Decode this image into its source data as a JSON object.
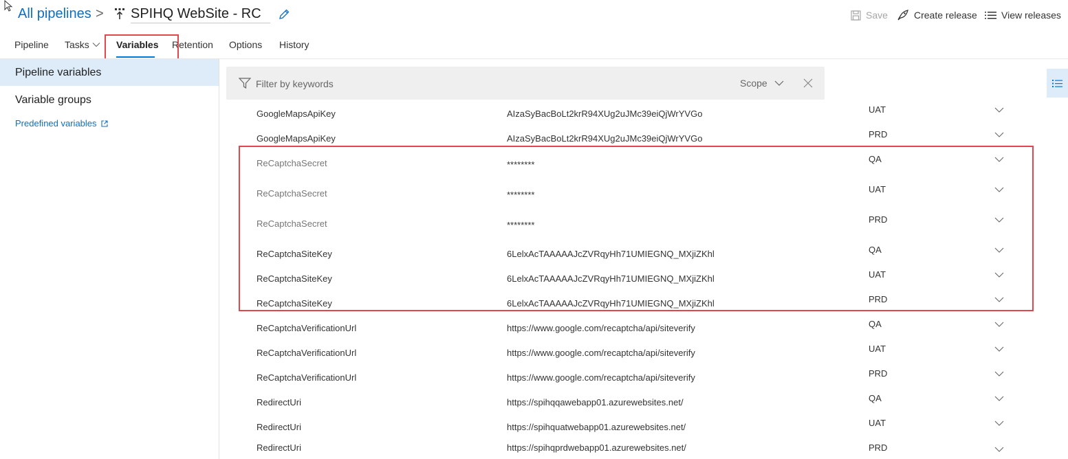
{
  "header": {
    "breadcrumb_root": "All pipelines",
    "breadcrumb_sep": ">",
    "pipeline_name": "SPIHQ WebSite - RC"
  },
  "commands": {
    "save": "Save",
    "create_release": "Create release",
    "view_releases": "View releases"
  },
  "tabs": [
    {
      "label": "Pipeline",
      "active": false
    },
    {
      "label": "Tasks",
      "active": false
    },
    {
      "label": "Variables",
      "active": true
    },
    {
      "label": "Retention",
      "active": false
    },
    {
      "label": "Options",
      "active": false
    },
    {
      "label": "History",
      "active": false
    }
  ],
  "nav": {
    "pipeline_variables": "Pipeline variables",
    "variable_groups": "Variable groups",
    "predefined_variables": "Predefined variables"
  },
  "filter": {
    "placeholder": "Filter by keywords",
    "scope_label": "Scope"
  },
  "variables": [
    {
      "name": "GoogleMapsApiKey",
      "value": "AIzaSyBacBoLt2krR94XUg2uJMc39eiQjWrYVGo",
      "scope": "UAT",
      "secret": false
    },
    {
      "name": "GoogleMapsApiKey",
      "value": "AIzaSyBacBoLt2krR94XUg2uJMc39eiQjWrYVGo",
      "scope": "PRD",
      "secret": false
    },
    {
      "name": "ReCaptchaSecret",
      "value": "********",
      "scope": "QA",
      "secret": true
    },
    {
      "name": "ReCaptchaSecret",
      "value": "********",
      "scope": "UAT",
      "secret": true
    },
    {
      "name": "ReCaptchaSecret",
      "value": "********",
      "scope": "PRD",
      "secret": true
    },
    {
      "name": "ReCaptchaSiteKey",
      "value": "6LelxAcTAAAAAJcZVRqyHh71UMIEGNQ_MXjiZKhl",
      "scope": "QA",
      "secret": false
    },
    {
      "name": "ReCaptchaSiteKey",
      "value": "6LelxAcTAAAAAJcZVRqyHh71UMIEGNQ_MXjiZKhl",
      "scope": "UAT",
      "secret": false
    },
    {
      "name": "ReCaptchaSiteKey",
      "value": "6LelxAcTAAAAAJcZVRqyHh71UMIEGNQ_MXjiZKhl",
      "scope": "PRD",
      "secret": false
    },
    {
      "name": "ReCaptchaVerificationUrl",
      "value": "https://www.google.com/recaptcha/api/siteverify",
      "scope": "QA",
      "secret": false
    },
    {
      "name": "ReCaptchaVerificationUrl",
      "value": "https://www.google.com/recaptcha/api/siteverify",
      "scope": "UAT",
      "secret": false
    },
    {
      "name": "ReCaptchaVerificationUrl",
      "value": "https://www.google.com/recaptcha/api/siteverify",
      "scope": "PRD",
      "secret": false
    },
    {
      "name": "RedirectUri",
      "value": "https://spihqqawebapp01.azurewebsites.net/",
      "scope": "QA",
      "secret": false
    },
    {
      "name": "RedirectUri",
      "value": "https://spihquatwebapp01.azurewebsites.net/",
      "scope": "UAT",
      "secret": false
    },
    {
      "name": "RedirectUri",
      "value": "https://spihqprdwebapp01.azurewebsites.net/",
      "scope": "PRD",
      "secret": false
    }
  ],
  "colors": {
    "accent": "#0078d4",
    "highlight": "#e0464c",
    "selected_bg": "#deecf9"
  }
}
